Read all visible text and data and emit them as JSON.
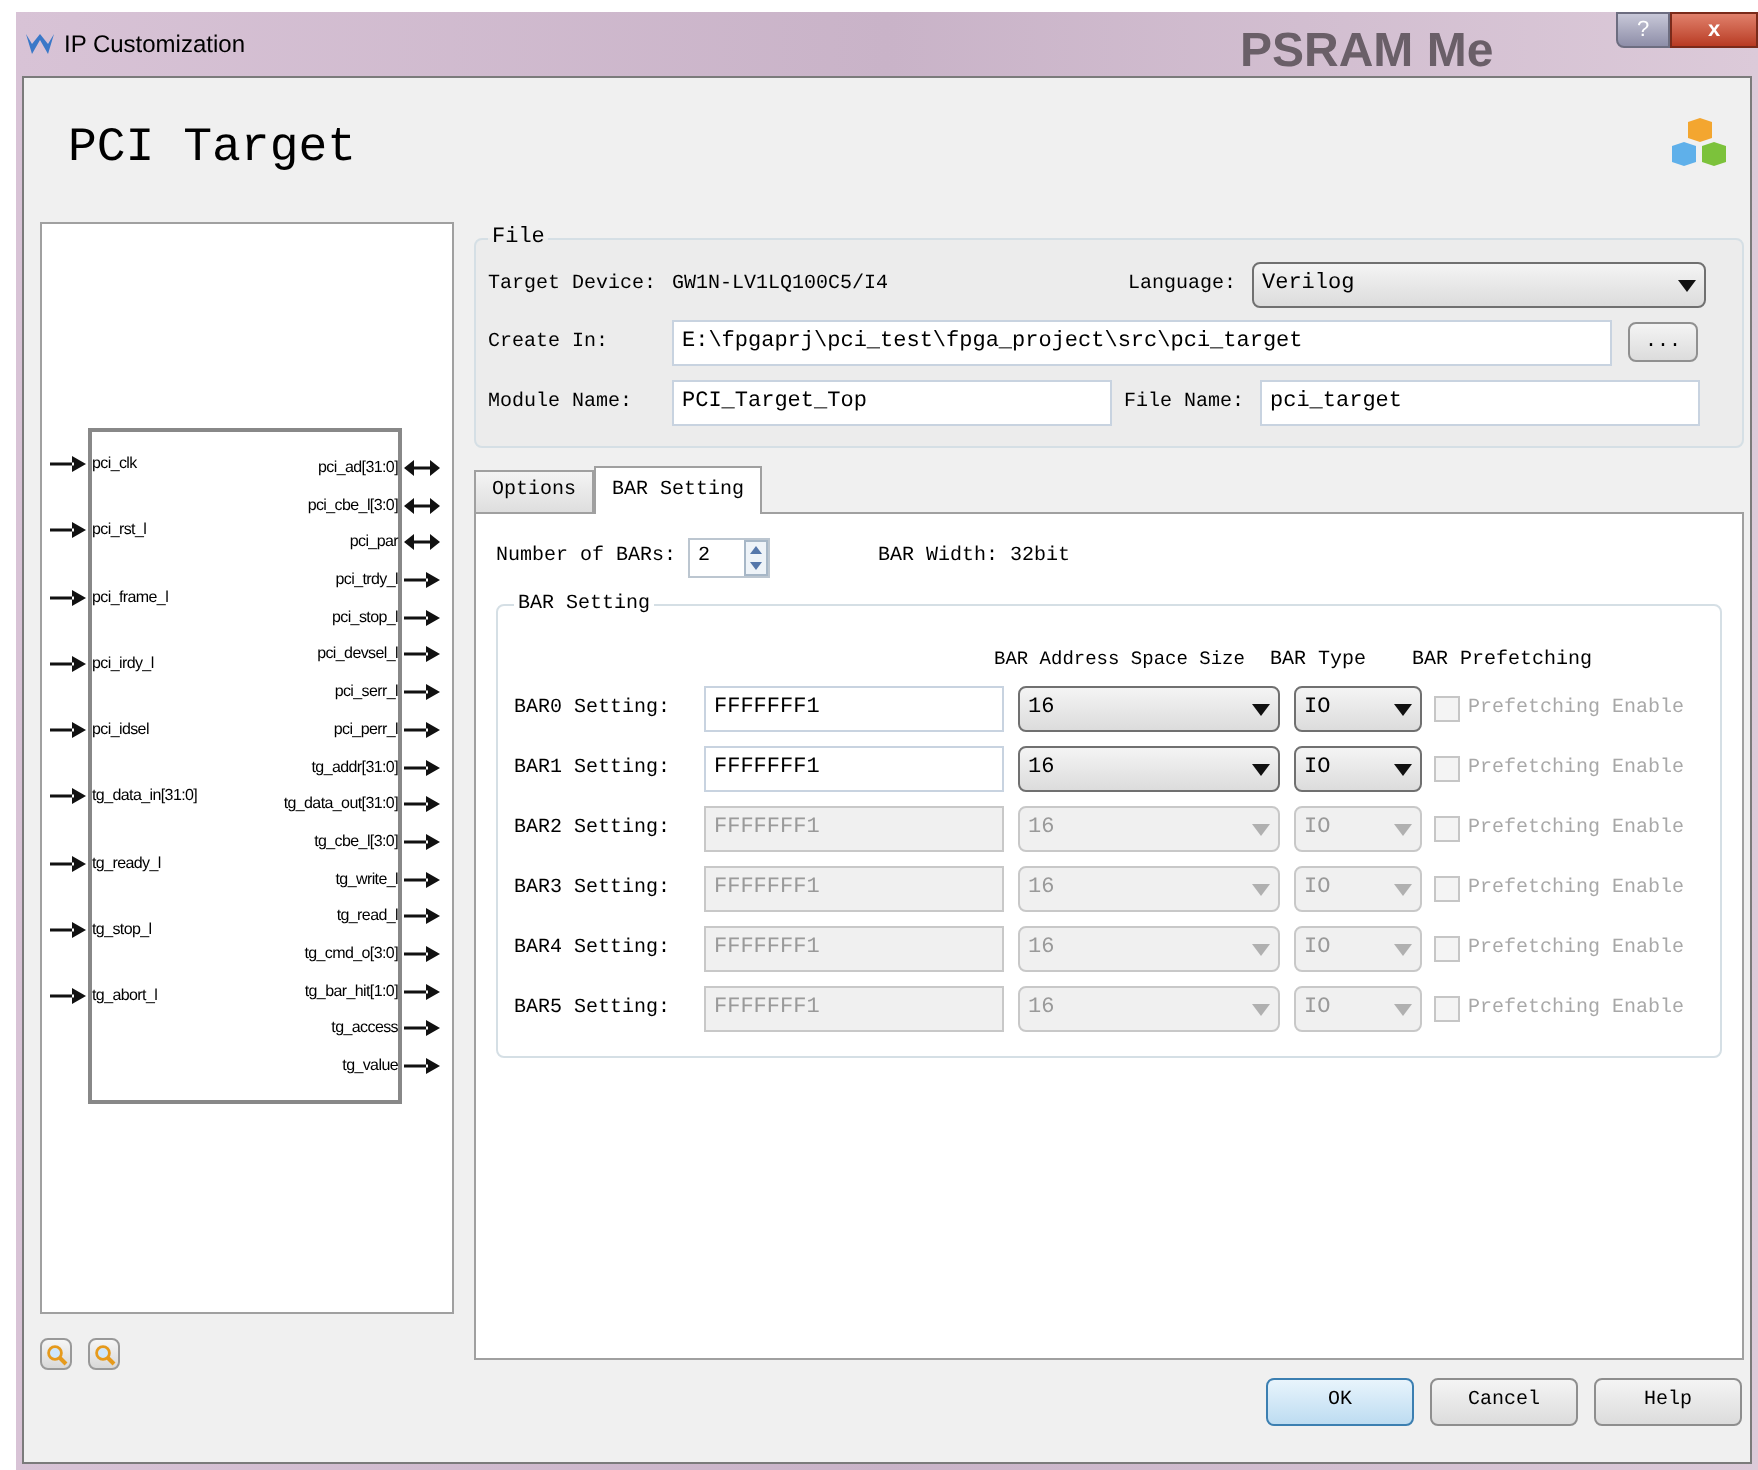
{
  "window": {
    "title": "IP Customization",
    "background_text": "PSRAM Me",
    "help_button": "?",
    "close_button": "x"
  },
  "heading": "PCI Target",
  "diagram": {
    "inputs": [
      {
        "name": "pci_clk"
      },
      {
        "name": "pci_rst_l"
      },
      {
        "name": "pci_frame_l"
      },
      {
        "name": "pci_irdy_l"
      },
      {
        "name": "pci_idsel"
      },
      {
        "name": "tg_data_in[31:0]"
      },
      {
        "name": "tg_ready_l"
      },
      {
        "name": "tg_stop_l"
      },
      {
        "name": "tg_abort_l"
      }
    ],
    "outputs": [
      {
        "name": "pci_ad[31:0]",
        "kind": "inout"
      },
      {
        "name": "pci_cbe_l[3:0]",
        "kind": "inout"
      },
      {
        "name": "pci_par",
        "kind": "inout"
      },
      {
        "name": "pci_trdy_l",
        "kind": "out"
      },
      {
        "name": "pci_stop_l",
        "kind": "out"
      },
      {
        "name": "pci_devsel_l",
        "kind": "out"
      },
      {
        "name": "pci_serr_l",
        "kind": "out"
      },
      {
        "name": "pci_perr_l",
        "kind": "out"
      },
      {
        "name": "tg_addr[31:0]",
        "kind": "out"
      },
      {
        "name": "tg_data_out[31:0]",
        "kind": "out"
      },
      {
        "name": "tg_cbe_l[3:0]",
        "kind": "out"
      },
      {
        "name": "tg_write_l",
        "kind": "out"
      },
      {
        "name": "tg_read_l",
        "kind": "out"
      },
      {
        "name": "tg_cmd_o[3:0]",
        "kind": "out"
      },
      {
        "name": "tg_bar_hit[1:0]",
        "kind": "out"
      },
      {
        "name": "tg_access",
        "kind": "out"
      },
      {
        "name": "tg_value",
        "kind": "out"
      }
    ]
  },
  "file": {
    "title": "File",
    "target_device_label": "Target Device:",
    "target_device": "GW1N-LV1LQ100C5/I4",
    "language_label": "Language:",
    "language": "Verilog",
    "create_in_label": "Create In:",
    "create_in": "E:\\fpgaprj\\pci_test\\fpga_project\\src\\pci_target",
    "browse_button": "...",
    "module_name_label": "Module Name:",
    "module_name": "PCI_Target_Top",
    "file_name_label": "File Name:",
    "file_name": "pci_target"
  },
  "tabs": [
    {
      "label": "Options",
      "selected": false
    },
    {
      "label": "BAR Setting",
      "selected": true
    }
  ],
  "bar_count_label": "Number of BARs:",
  "bar_count": "2",
  "bar_width": "BAR Width: 32bit",
  "bar_setting": {
    "title": "BAR Setting",
    "columns": [
      "BAR Address Space Size",
      "BAR Type",
      "BAR Prefetching"
    ],
    "rows": [
      {
        "label": "BAR0 Setting:",
        "value": "FFFFFFF1",
        "size": "16",
        "type": "IO",
        "prefetch": "Prefetching Enable",
        "disabled": false,
        "prefetch_checked": false
      },
      {
        "label": "BAR1 Setting:",
        "value": "FFFFFFF1",
        "size": "16",
        "type": "IO",
        "prefetch": "Prefetching Enable",
        "disabled": false,
        "prefetch_checked": false
      },
      {
        "label": "BAR2 Setting:",
        "value": "FFFFFFF1",
        "size": "16",
        "type": "IO",
        "prefetch": "Prefetching Enable",
        "disabled": true,
        "prefetch_checked": false
      },
      {
        "label": "BAR3 Setting:",
        "value": "FFFFFFF1",
        "size": "16",
        "type": "IO",
        "prefetch": "Prefetching Enable",
        "disabled": true,
        "prefetch_checked": false
      },
      {
        "label": "BAR4 Setting:",
        "value": "FFFFFFF1",
        "size": "16",
        "type": "IO",
        "prefetch": "Prefetching Enable",
        "disabled": true,
        "prefetch_checked": false
      },
      {
        "label": "BAR5 Setting:",
        "value": "FFFFFFF1",
        "size": "16",
        "type": "IO",
        "prefetch": "Prefetching Enable",
        "disabled": true,
        "prefetch_checked": false
      }
    ]
  },
  "buttons": [
    "OK",
    "Cancel",
    "Help"
  ]
}
